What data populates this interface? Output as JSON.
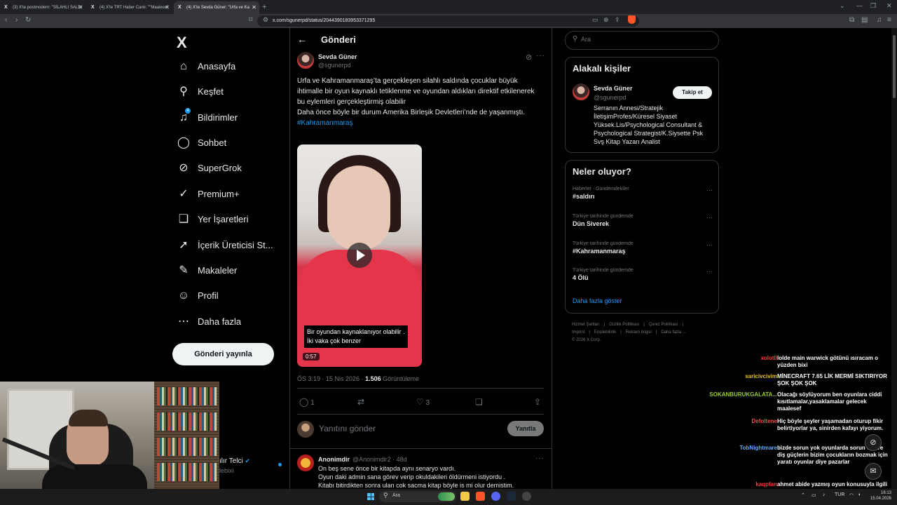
{
  "browser": {
    "tabs": [
      {
        "title": "(3) X'te postmodern: \"SİLAHLI SALDI",
        "active": false
      },
      {
        "title": "(4) X'te TRT Haber Canlı: \"\"Maalesef",
        "active": false
      },
      {
        "title": "(4) X'te Sevda Güner: \"Urfa ve Ka",
        "active": true
      }
    ],
    "url": "x.com/sgunerpd/status/2044390183953371295"
  },
  "sidebar": {
    "logo": "X",
    "items": [
      {
        "label": "Anasayfa",
        "icon": "home-icon",
        "glyph": "⌂"
      },
      {
        "label": "Keşfet",
        "icon": "search-icon",
        "glyph": "⚲"
      },
      {
        "label": "Bildirimler",
        "icon": "bell-icon",
        "glyph": "🔔",
        "badge": "4"
      },
      {
        "label": "Sohbet",
        "icon": "chat-icon",
        "glyph": "◯"
      },
      {
        "label": "SuperGrok",
        "icon": "grok-icon",
        "glyph": "⊘"
      },
      {
        "label": "Premium+",
        "icon": "premium-icon",
        "glyph": "✓"
      },
      {
        "label": "Yer İşaretleri",
        "icon": "bookmark-icon",
        "glyph": "❏"
      },
      {
        "label": "İçerik Üreticisi St...",
        "icon": "rocket-icon",
        "glyph": "➚"
      },
      {
        "label": "Makaleler",
        "icon": "article-icon",
        "glyph": "✎"
      },
      {
        "label": "Profil",
        "icon": "person-icon",
        "glyph": "☺"
      },
      {
        "label": "Daha fazla",
        "icon": "more-circle-icon",
        "glyph": "⋯"
      }
    ],
    "post_button": "Gönderi yayınla",
    "account": {
      "name": "ılır Telci",
      "handle": "lebixi"
    }
  },
  "main": {
    "header_title": "Gönderi",
    "tweet": {
      "author": "Sevda Güner",
      "handle": "@sgunerpd",
      "text_lines": [
        "Urfa ve  Kahramanmaraş’ta gerçekleşen silahlı saldında çocuklar büyük ihtimalle bir oyun kaynaklı tetiklenme ve oyundan aldıkları direktif etkilenerek bu eylemleri gerçekleştirmiş olabilir",
        "Daha önce böyle bir durum Amerika Birleşik Devletleri’nde de yaşanmıştı."
      ],
      "hashtag": "#Kahramanmaraş",
      "video_caption_1": "Bir oyundan kaynaklanıyor olabilir .",
      "video_caption_2": "İki vaka çok benzer",
      "video_duration": "0:57",
      "time": "ÖS 3:19 · 15 Nis 2026 · ",
      "views": "1.506",
      "views_label": " Görüntüleme",
      "replies": "1",
      "likes": "3"
    },
    "reply_placeholder": "Yanıtını gönder",
    "reply_button": "Yanıtla",
    "comment": {
      "author": "Anonimdir",
      "handle": "@Anonimdir2 · 48d",
      "lines": [
        "On  beş sene önce bir kitapda aynı senaryo vardı.",
        "Oyun daki admin sana görev verip okuldakileri öldürmeni istiyordu .",
        "Kitabı bitirdikten sonra ulan cok sacma kitap böyle is mi olur demistim."
      ]
    }
  },
  "right": {
    "search_placeholder": "Ara",
    "related_title": "Alakalı kişiler",
    "related": {
      "name": "Sevda Güner",
      "handle": "@sgunerpd",
      "follow": "Takip et",
      "bio": "Serranın Annesi/Stratejik İletişimProfes/Küresel Siyaset Yüksek.Lis/Psychological Consultant & Psychological Strategist/K.Siysette Psk Svş Kitap Yazarı Analist"
    },
    "trends_title": "Neler oluyor?",
    "trends": [
      {
        "category": "Haberler · Gündemdekiler",
        "name": "#saldırı"
      },
      {
        "category": "Türkiye tarihinde gündemde",
        "name": "Dün Siverek"
      },
      {
        "category": "Türkiye tarihinde gündemde",
        "name": "#Kahramanmaraş"
      },
      {
        "category": "Türkiye tarihinde gündemde",
        "name": "4 Ölü"
      }
    ],
    "show_more": "Daha fazla göster",
    "footer": [
      "Hizmet Şartları",
      "Gizlilik Politikası",
      "Çerez Politikası",
      "Imprint",
      "Erişilebilirlik",
      "Reklam bilgisi",
      "Daha fazla ...",
      "© 2026 X Corp."
    ]
  },
  "stream_chat": [
    {
      "user": "xolotll",
      "color": "#ff3b3b",
      "msg": "lolde main warwick götünü ısıracam o yüzden bixi"
    },
    {
      "user": "saricivcivim",
      "color": "#e6c229",
      "msg": "MİNECRAFT 7.65 LİK MERMİ SIKTIRIYOR ŞOK ŞOK ŞOK"
    },
    {
      "user": "SOKANBURUKGALATA...",
      "color": "#9acd32",
      "msg": "Olacağı söylüyorum ben oyunlara ciddi kısıtlamalar,yasaklamalar gelecek maalesef"
    },
    {
      "user": "Defoltene",
      "color": "#ff4d4d",
      "msg": "Hiç böyle şeyler yaşamadan oturup fikir belirtiyorlar ya, sinirden kafayı yiyorum."
    },
    {
      "user": "TobNightmare",
      "color": "#5fa8ff",
      "msg": "bizde sorun yok oyunlarda sorun var ve diş güçlerin bizim çocukların bozmak için yaratı oyunlar diye pazarlar"
    },
    {
      "user": "kaqpfan",
      "color": "#ff3b3b",
      "msg": "ahmet abide yazmış oyun konusuyla ilgili"
    }
  ],
  "taskbar": {
    "search_placeholder": "Ara",
    "lang": "TUR",
    "time": "16:13",
    "date": "15.04.2026"
  }
}
